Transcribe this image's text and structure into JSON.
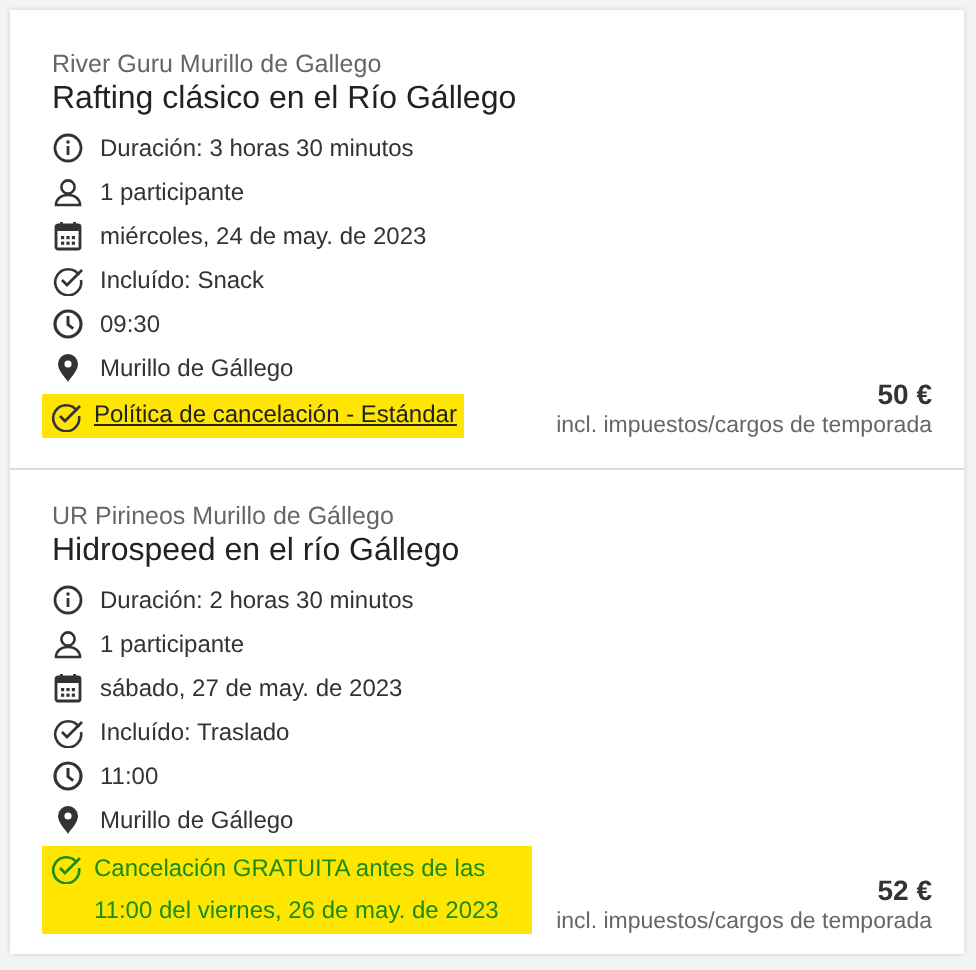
{
  "bookings": [
    {
      "vendor": "River Guru Murillo de Gallego",
      "title": "Rafting clásico en el Río Gállego",
      "details": [
        {
          "kind": "info",
          "text": "Duración: 3 horas 30 minutos"
        },
        {
          "kind": "person",
          "text": "1 participante"
        },
        {
          "kind": "calendar",
          "text": "miércoles, 24 de may. de 2023"
        },
        {
          "kind": "check",
          "text": "Incluído: Snack"
        },
        {
          "kind": "clock",
          "text": "09:30"
        },
        {
          "kind": "pin",
          "text": "Murillo de Gállego"
        }
      ],
      "policy": {
        "kind": "link",
        "text": "Política de cancelación - Estándar"
      },
      "price": "50 €",
      "price_note": "incl. impuestos/cargos de temporada"
    },
    {
      "vendor": "UR Pirineos Murillo de Gállego",
      "title": "Hidrospeed en el río Gállego",
      "details": [
        {
          "kind": "info",
          "text": "Duración: 2 horas 30 minutos"
        },
        {
          "kind": "person",
          "text": "1 participante"
        },
        {
          "kind": "calendar",
          "text": "sábado, 27 de may. de 2023"
        },
        {
          "kind": "check",
          "text": "Incluído: Traslado"
        },
        {
          "kind": "clock",
          "text": "11:00"
        },
        {
          "kind": "pin",
          "text": "Murillo de Gállego"
        }
      ],
      "policy": {
        "kind": "free",
        "text": "Cancelación GRATUITA antes de las 11:00 del viernes, 26 de may. de 2023"
      },
      "price": "52 €",
      "price_note": "incl. impuestos/cargos de temporada"
    }
  ]
}
